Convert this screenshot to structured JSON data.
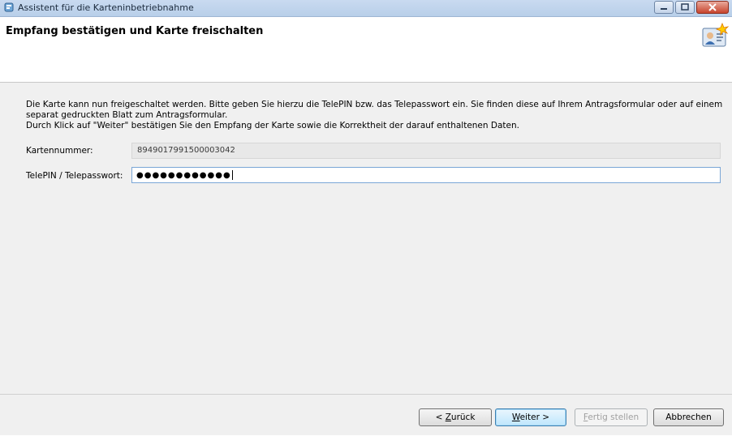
{
  "window": {
    "title": "Assistent für die Karteninbetriebnahme"
  },
  "header": {
    "heading": "Empfang bestätigen und Karte freischalten"
  },
  "description": {
    "line1": "Die Karte kann nun freigeschaltet werden. Bitte geben Sie hierzu die TelePIN bzw. das Telepasswort ein. Sie finden diese auf Ihrem Antragsformular oder auf einem separat gedruckten Blatt zum Antragsformular.",
    "line2": "Durch Klick auf \"Weiter\" bestätigen Sie den Empfang der Karte sowie die Korrektheit der darauf enthaltenen Daten."
  },
  "form": {
    "card_number_label": "Kartennummer:",
    "card_number_value": "8949017991500003042",
    "telepin_label": "TelePIN / Telepasswort:",
    "telepin_masked": "●●●●●●●●●●●●"
  },
  "buttons": {
    "back_prefix": "< ",
    "back_mnemonic": "Z",
    "back_rest": "urück",
    "next_mnemonic": "W",
    "next_rest": "eiter >",
    "finish_mnemonic": "F",
    "finish_rest": "ertig stellen",
    "cancel": "Abbrechen"
  },
  "icons": {
    "app_icon": "wizard-icon",
    "header_icon": "id-card-icon"
  }
}
